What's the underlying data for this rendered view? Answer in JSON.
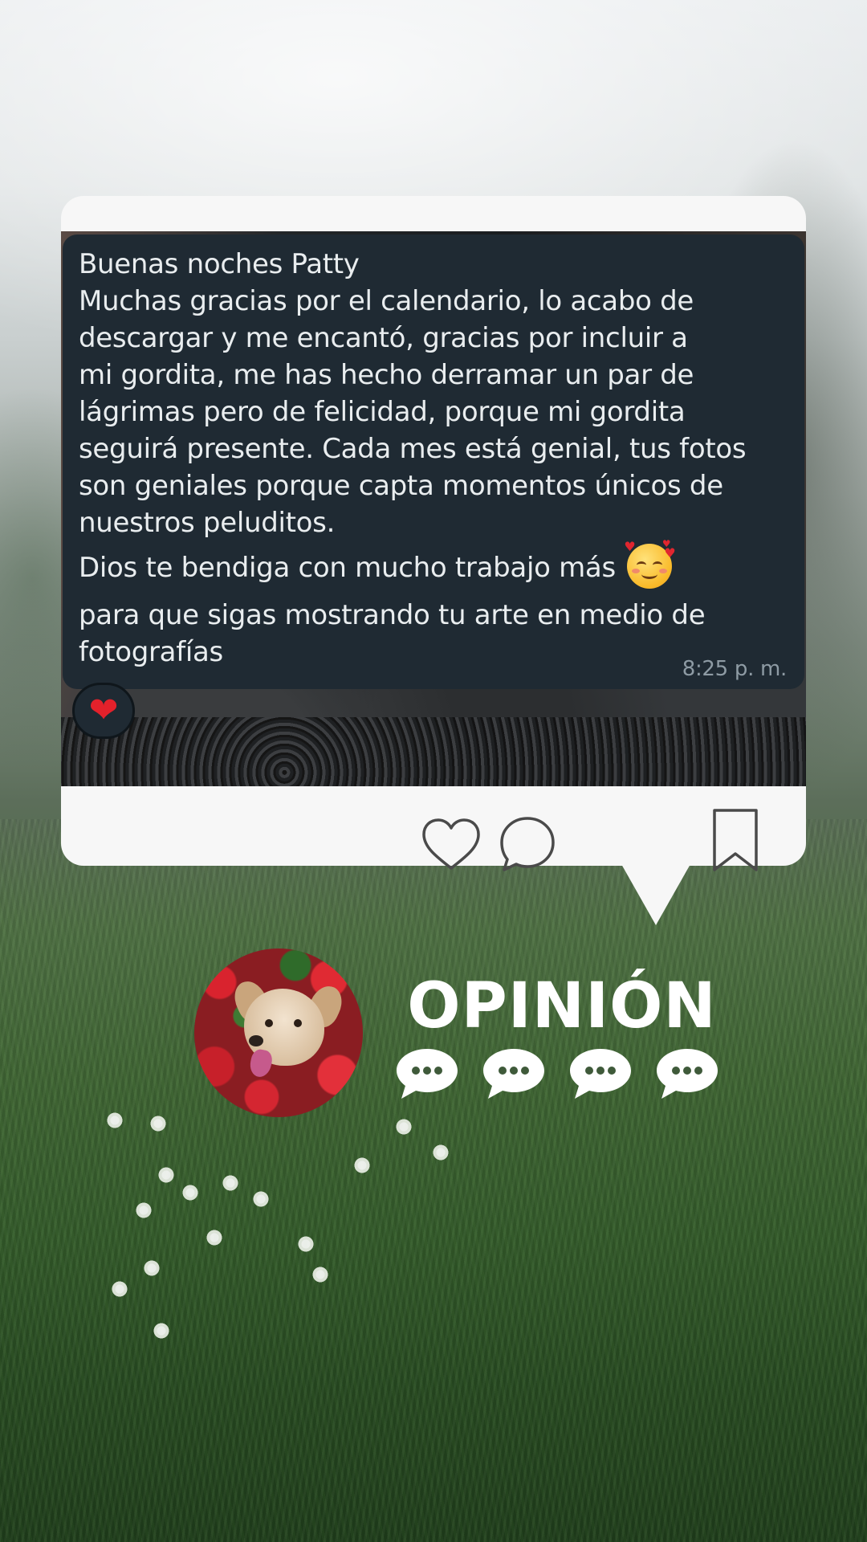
{
  "post": {
    "message_lines_p1": [
      "Buenas noches Patty",
      "Muchas gracias por el calendario, lo acabo de",
      "descargar y me encantó, gracias por incluir a",
      "mi gordita, me has hecho derramar un par de",
      "lágrimas pero de felicidad, porque mi gordita",
      "seguirá presente. Cada mes está genial, tus fotos",
      "son geniales porque capta momentos únicos de",
      "nuestros peluditos."
    ],
    "message_line_p2": "Dios te bendiga con mucho trabajo más",
    "message_emoji": "smiling-face-with-hearts",
    "message_lines_p3": [
      "para que sigas mostrando tu arte en medio de",
      "fotografías"
    ],
    "timestamp": "8:25 p. m.",
    "reaction": "❤",
    "actions": {
      "like_icon": "heart-outline",
      "comment_icon": "speech-bubble-outline",
      "bookmark_icon": "bookmark-outline"
    }
  },
  "branding": {
    "title": "OPINIÓN",
    "chat_icon_count": 4,
    "avatar_subject": "dog-among-red-flowers"
  },
  "colors": {
    "card_bg": "#f7f7f7",
    "chat_bubble_bg": "#1f2a33",
    "chat_text": "#e9edef",
    "timestamp_text": "#8e9ba4",
    "reaction_heart": "#e3212b",
    "title_text": "#ffffff"
  }
}
